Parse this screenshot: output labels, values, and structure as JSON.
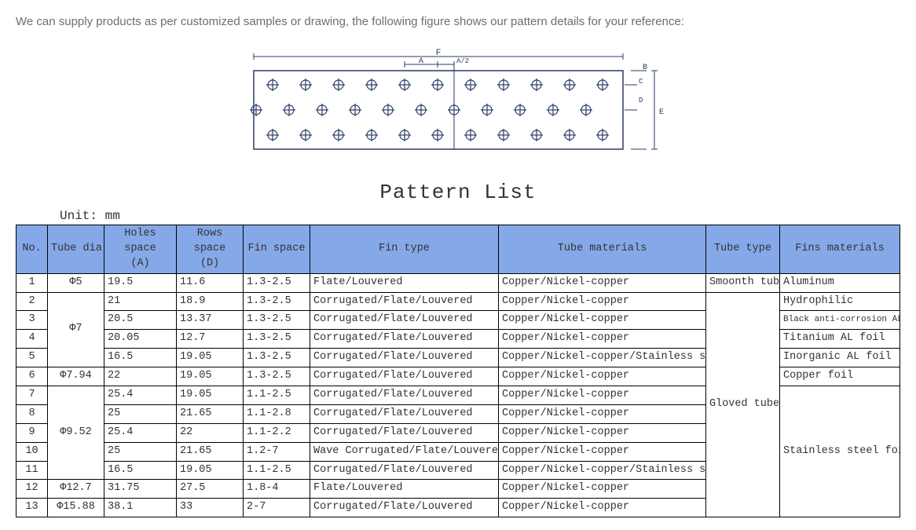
{
  "intro": "We can supply products as per customized samples or drawing, the following figure shows our pattern details for your reference:",
  "title": "Pattern List",
  "unit": "Unit: mm",
  "headers": {
    "no": "No.",
    "dia": "Tube dia.",
    "a": "Holes space\n(A)",
    "d": "Rows space\n(D)",
    "fs": "Fin space",
    "ft": "Fin type",
    "tm": "Tube materials",
    "tt": "Tube type",
    "fm": "Fins materials"
  },
  "tube_dia_groups": [
    {
      "label": "Φ5",
      "rowspan": 1
    },
    {
      "label": "Φ7",
      "rowspan": 4
    },
    {
      "label": "Φ7.94",
      "rowspan": 1
    },
    {
      "label": "Φ9.52",
      "rowspan": 5
    },
    {
      "label": "Φ12.7",
      "rowspan": 1
    },
    {
      "label": "Φ15.88",
      "rowspan": 1
    }
  ],
  "rows": [
    {
      "no": "1",
      "a": "19.5",
      "d": "11.6",
      "fs": "1.3-2.5",
      "ft": "Flate/Louvered",
      "tm": "Copper/Nickel-copper"
    },
    {
      "no": "2",
      "a": "21",
      "d": "18.9",
      "fs": "1.3-2.5",
      "ft": "Corrugated/Flate/Louvered",
      "tm": "Copper/Nickel-copper"
    },
    {
      "no": "3",
      "a": "20.5",
      "d": "13.37",
      "fs": "1.3-2.5",
      "ft": "Corrugated/Flate/Louvered",
      "tm": "Copper/Nickel-copper"
    },
    {
      "no": "4",
      "a": "20.05",
      "d": "12.7",
      "fs": "1.3-2.5",
      "ft": "Corrugated/Flate/Louvered",
      "tm": "Copper/Nickel-copper"
    },
    {
      "no": "5",
      "a": "16.5",
      "d": "19.05",
      "fs": "1.3-2.5",
      "ft": "Corrugated/Flate/Louvered",
      "tm": "Copper/Nickel-copper/Stainless steel"
    },
    {
      "no": "6",
      "a": "22",
      "d": "19.05",
      "fs": "1.3-2.5",
      "ft": "Corrugated/Flate/Louvered",
      "tm": "Copper/Nickel-copper"
    },
    {
      "no": "7",
      "a": "25.4",
      "d": "19.05",
      "fs": "1.1-2.5",
      "ft": "Corrugated/Flate/Louvered",
      "tm": "Copper/Nickel-copper"
    },
    {
      "no": "8",
      "a": "25",
      "d": "21.65",
      "fs": "1.1-2.8",
      "ft": "Corrugated/Flate/Louvered",
      "tm": "Copper/Nickel-copper"
    },
    {
      "no": "9",
      "a": "25.4",
      "d": "22",
      "fs": "1.1-2.2",
      "ft": "Corrugated/Flate/Louvered",
      "tm": "Copper/Nickel-copper"
    },
    {
      "no": "10",
      "a": "25",
      "d": "21.65",
      "fs": "1.2-7",
      "ft": "Wave Corrugated/Flate/Louvered",
      "tm": "Copper/Nickel-copper"
    },
    {
      "no": "11",
      "a": "16.5",
      "d": "19.05",
      "fs": "1.1-2.5",
      "ft": "Corrugated/Flate/Louvered",
      "tm": "Copper/Nickel-copper/Stainless steel"
    },
    {
      "no": "12",
      "a": "31.75",
      "d": "27.5",
      "fs": "1.8-4",
      "ft": "Flate/Louvered",
      "tm": "Copper/Nickel-copper"
    },
    {
      "no": "13",
      "a": "38.1",
      "d": "33",
      "fs": "2-7",
      "ft": "Corrugated/Flate/Louvered",
      "tm": "Copper/Nickel-copper"
    }
  ],
  "tube_type": [
    "Smoonth tube",
    "Gloved tube"
  ],
  "fins_materials": [
    "Aluminum",
    "Hydrophilic",
    "Black anti-corrosion AL foil",
    "Titanium AL foil",
    "Inorganic AL foil",
    "Copper foil",
    "Stainless steel foil"
  ],
  "diagram_labels": {
    "F": "F",
    "A": "A",
    "A2": "A/2",
    "B": "B",
    "C": "C",
    "D": "D",
    "E": "E"
  }
}
